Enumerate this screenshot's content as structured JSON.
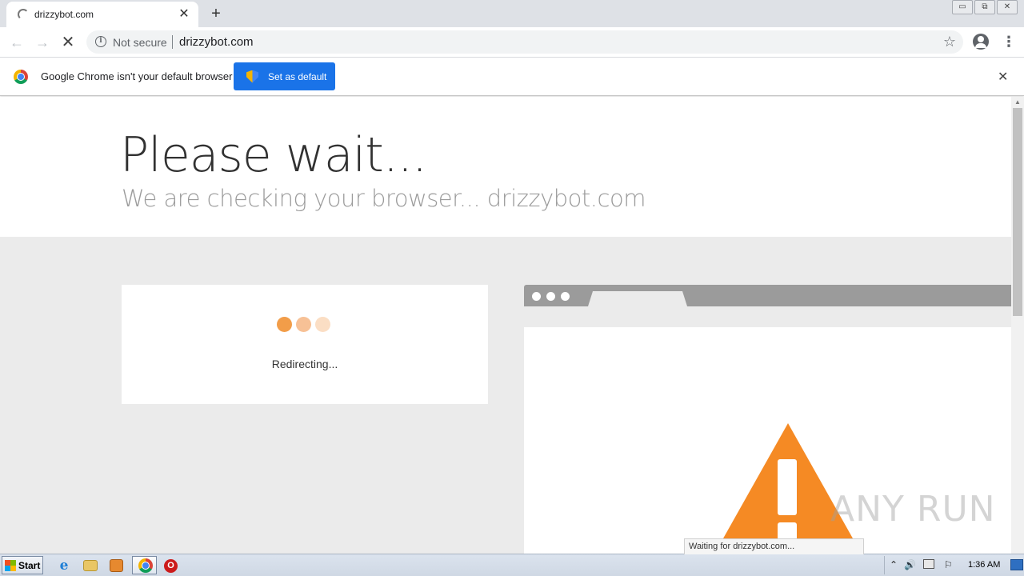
{
  "browser": {
    "tab": {
      "title": "drizzybot.com",
      "close": "✕"
    },
    "new_tab": "+",
    "window_controls": {
      "minimize": "▭",
      "restore": "⧉",
      "close": "✕"
    },
    "toolbar": {
      "back": "←",
      "forward": "→",
      "stop": "✕",
      "security_icon": "i",
      "security_label": "Not secure",
      "url": "drizzybot.com",
      "bookmark_icon": "☆",
      "menu_icon": "⋮"
    },
    "infobar": {
      "message": "Google Chrome isn't your default browser",
      "button_label": "Set as default",
      "close": "✕"
    }
  },
  "page": {
    "headline": "Please wait...",
    "subheadline": "We are checking your browser... drizzybot.com",
    "status": "Redirecting...",
    "watermark": "ANY RUN"
  },
  "status_bubble": "Waiting for drizzybot.com...",
  "taskbar": {
    "start_label": "Start",
    "ie_icon": "e",
    "opera_icon": "O",
    "tray": {
      "chevron": "⌃",
      "volume": "🔊",
      "flag": "⚐"
    },
    "clock": "1:36 AM"
  },
  "colors": {
    "accent_blue": "#1a73e8",
    "loader_orange": "#f29d49",
    "warning_orange": "#f58a24",
    "page_bg": "#ebebeb"
  }
}
